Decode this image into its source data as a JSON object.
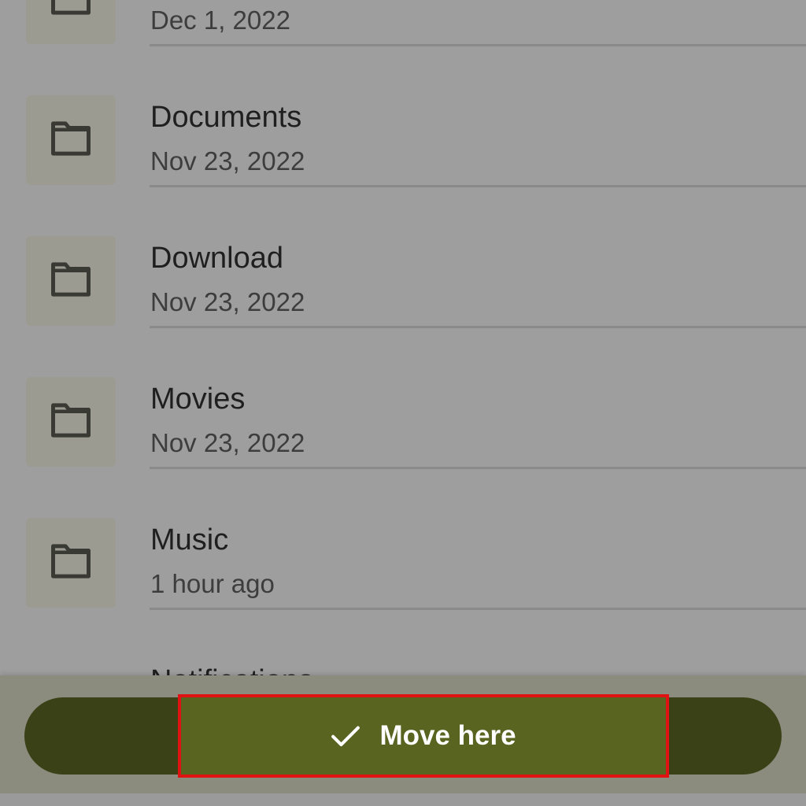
{
  "folders": [
    {
      "name": "",
      "date": "Dec 1, 2022"
    },
    {
      "name": "Documents",
      "date": "Nov 23, 2022"
    },
    {
      "name": "Download",
      "date": "Nov 23, 2022"
    },
    {
      "name": "Movies",
      "date": "Nov 23, 2022"
    },
    {
      "name": "Music",
      "date": "1 hour ago"
    }
  ],
  "partial_item": {
    "name": "Notifications"
  },
  "action": {
    "move_label": "Move here",
    "icon": "check-icon"
  },
  "colors": {
    "scrim": "#9e9e9e",
    "button_pill": "#3a4117",
    "button_highlight": "#586420",
    "highlight_border": "#e11212"
  }
}
